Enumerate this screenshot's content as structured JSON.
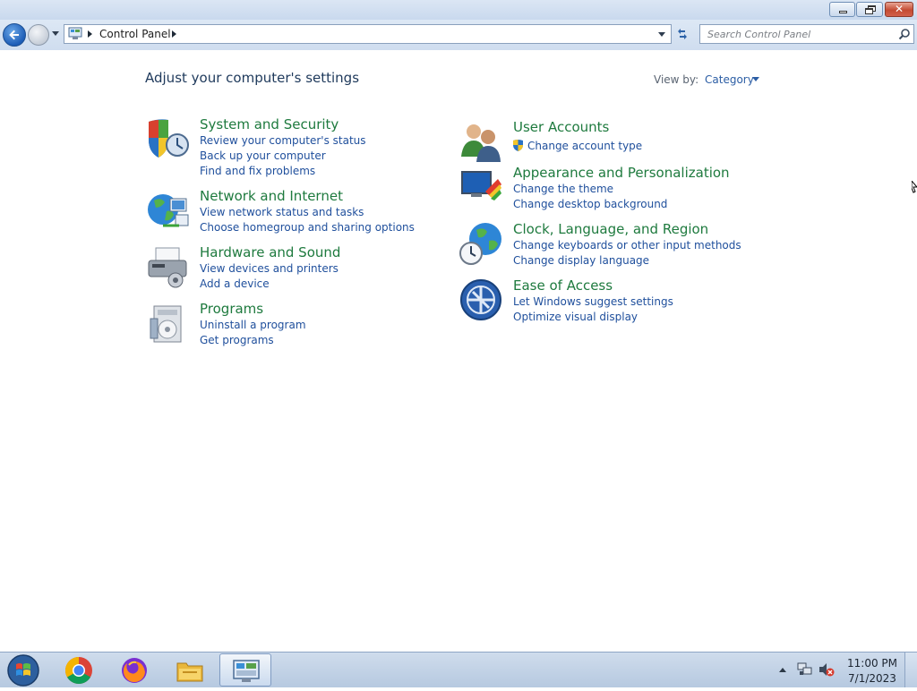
{
  "address_bar": {
    "path": "Control Panel"
  },
  "search": {
    "placeholder": "Search Control Panel"
  },
  "main": {
    "title": "Adjust your computer's settings",
    "view_by_label": "View by:",
    "view_by_value": "Category"
  },
  "categories_left": [
    {
      "title": "System and Security",
      "links": [
        "Review your computer's status",
        "Back up your computer",
        "Find and fix problems"
      ]
    },
    {
      "title": "Network and Internet",
      "links": [
        "View network status and tasks",
        "Choose homegroup and sharing options"
      ]
    },
    {
      "title": "Hardware and Sound",
      "links": [
        "View devices and printers",
        "Add a device"
      ]
    },
    {
      "title": "Programs",
      "links": [
        "Uninstall a program",
        "Get programs"
      ]
    }
  ],
  "categories_right": [
    {
      "title": "User Accounts",
      "links": [
        "Change account type"
      ]
    },
    {
      "title": "Appearance and Personalization",
      "links": [
        "Change the theme",
        "Change desktop background"
      ]
    },
    {
      "title": "Clock, Language, and Region",
      "links": [
        "Change keyboards or other input methods",
        "Change display language"
      ]
    },
    {
      "title": "Ease of Access",
      "links": [
        "Let Windows suggest settings",
        "Optimize visual display"
      ]
    }
  ],
  "taskbar": {
    "apps": [
      "chrome-icon",
      "firefox-icon",
      "file-explorer-icon",
      "control-panel-icon"
    ],
    "time": "11:00 PM",
    "date": "7/1/2023"
  },
  "colors": {
    "category_title": "#1e7a3e",
    "link": "#1f4f9c",
    "heading": "#1e395b"
  }
}
